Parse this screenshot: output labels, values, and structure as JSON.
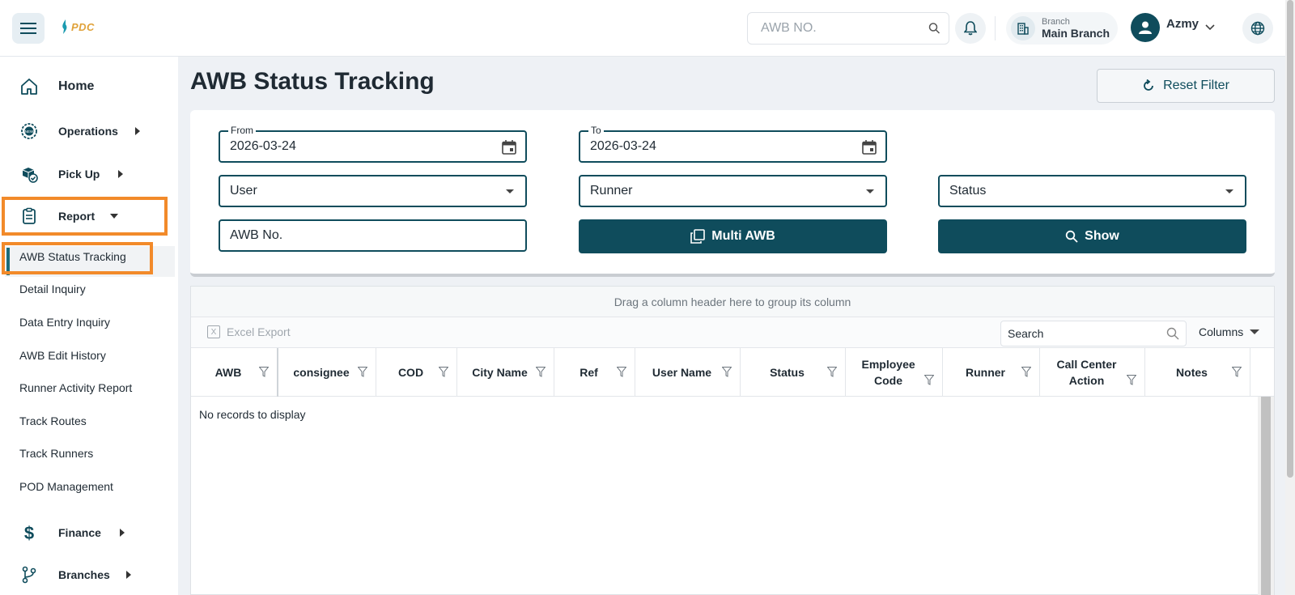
{
  "header": {
    "logo_text": "PDC",
    "search_placeholder": "AWB NO.",
    "branch_label": "Branch",
    "branch_value": "Main Branch",
    "user_name": "Azmy"
  },
  "sidebar": {
    "items": [
      {
        "label": "Home",
        "icon": "home-icon"
      },
      {
        "label": "Operations",
        "icon": "operations-icon"
      },
      {
        "label": "Pick Up",
        "icon": "pickup-icon"
      },
      {
        "label": "Report",
        "icon": "report-icon"
      },
      {
        "label": "Finance",
        "icon": "dollar-icon"
      },
      {
        "label": "Branches",
        "icon": "branches-icon"
      }
    ],
    "report_subitems": [
      "AWB Status Tracking",
      "Detail Inquiry",
      "Data Entry Inquiry",
      "AWB Edit History",
      "Runner Activity Report",
      "Track Routes",
      "Track Runners",
      "POD Management"
    ]
  },
  "page": {
    "title": "AWB Status Tracking",
    "reset_label": "Reset Filter"
  },
  "filters": {
    "from_label": "From",
    "from_value": "2026-03-24",
    "to_label": "To",
    "to_value": "2026-03-24",
    "user_value": "User",
    "runner_value": "Runner",
    "status_value": "Status",
    "awb_placeholder": "AWB No.",
    "multi_awb_label": "Multi AWB",
    "show_label": "Show"
  },
  "grid": {
    "group_hint": "Drag a column header here to group its column",
    "excel_label": "Excel Export",
    "search_placeholder": "Search",
    "columns_label": "Columns",
    "headers": [
      "AWB",
      "consignee",
      "COD",
      "City Name",
      "Ref",
      "User Name",
      "Status",
      "Employee Code",
      "Runner",
      "Call Center Action",
      "Notes"
    ],
    "empty_text": "No records to display"
  },
  "colors": {
    "primary": "#0f4c5c",
    "highlight": "#f28a2a"
  }
}
